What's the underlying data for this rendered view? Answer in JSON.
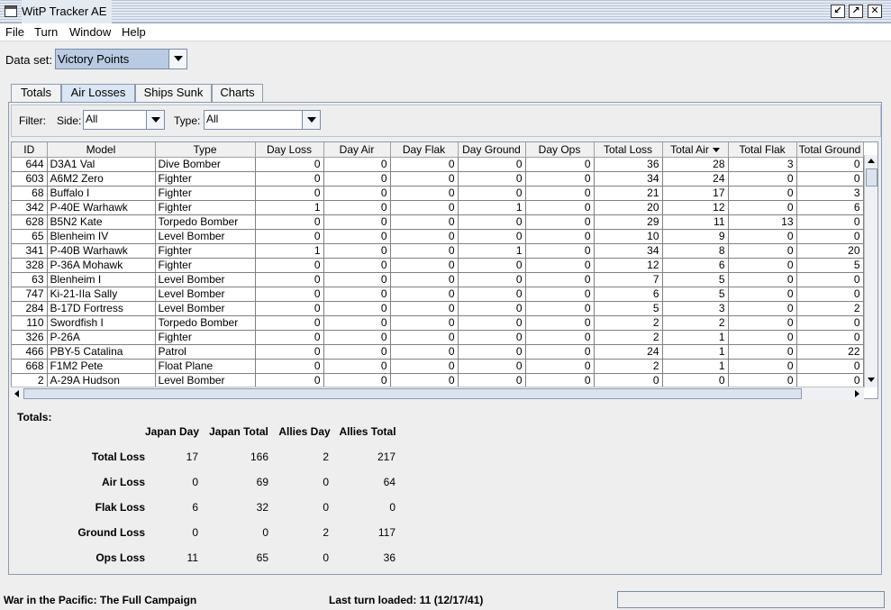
{
  "window": {
    "title": "WitP Tracker AE"
  },
  "menu": [
    "File",
    "Turn",
    "Window",
    "Help"
  ],
  "dataset": {
    "label": "Data set:",
    "value": "Victory Points"
  },
  "tabs": [
    "Totals",
    "Air Losses",
    "Ships Sunk",
    "Charts"
  ],
  "filter": {
    "label": "Filter:",
    "side_label": "Side:",
    "side_value": "All",
    "type_label": "Type:",
    "type_value": "All"
  },
  "table": {
    "columns": [
      "ID",
      "Model",
      "Type",
      "Day Loss",
      "Day Air",
      "Day Flak",
      "Day Ground",
      "Day Ops",
      "Total Loss",
      "Total Air",
      "Total Flak",
      "Total Ground"
    ],
    "rows": [
      [
        "644",
        "D3A1 Val",
        "Dive Bomber",
        "0",
        "0",
        "0",
        "0",
        "0",
        "36",
        "28",
        "3",
        "0"
      ],
      [
        "603",
        "A6M2 Zero",
        "Fighter",
        "0",
        "0",
        "0",
        "0",
        "0",
        "34",
        "24",
        "0",
        "0"
      ],
      [
        "68",
        "Buffalo I",
        "Fighter",
        "0",
        "0",
        "0",
        "0",
        "0",
        "21",
        "17",
        "0",
        "3"
      ],
      [
        "342",
        "P-40E Warhawk",
        "Fighter",
        "1",
        "0",
        "0",
        "1",
        "0",
        "20",
        "12",
        "0",
        "6"
      ],
      [
        "628",
        "B5N2 Kate",
        "Torpedo Bomber",
        "0",
        "0",
        "0",
        "0",
        "0",
        "29",
        "11",
        "13",
        "0"
      ],
      [
        "65",
        "Blenheim IV",
        "Level Bomber",
        "0",
        "0",
        "0",
        "0",
        "0",
        "10",
        "9",
        "0",
        "0"
      ],
      [
        "341",
        "P-40B Warhawk",
        "Fighter",
        "1",
        "0",
        "0",
        "1",
        "0",
        "34",
        "8",
        "0",
        "20"
      ],
      [
        "328",
        "P-36A Mohawk",
        "Fighter",
        "0",
        "0",
        "0",
        "0",
        "0",
        "12",
        "6",
        "0",
        "5"
      ],
      [
        "63",
        "Blenheim I",
        "Level Bomber",
        "0",
        "0",
        "0",
        "0",
        "0",
        "7",
        "5",
        "0",
        "0"
      ],
      [
        "747",
        "Ki-21-IIa Sally",
        "Level Bomber",
        "0",
        "0",
        "0",
        "0",
        "0",
        "6",
        "5",
        "0",
        "0"
      ],
      [
        "284",
        "B-17D Fortress",
        "Level Bomber",
        "0",
        "0",
        "0",
        "0",
        "0",
        "5",
        "3",
        "0",
        "2"
      ],
      [
        "110",
        "Swordfish I",
        "Torpedo Bomber",
        "0",
        "0",
        "0",
        "0",
        "0",
        "2",
        "2",
        "0",
        "0"
      ],
      [
        "326",
        "P-26A",
        "Fighter",
        "0",
        "0",
        "0",
        "0",
        "0",
        "2",
        "1",
        "0",
        "0"
      ],
      [
        "466",
        "PBY-5 Catalina",
        "Patrol",
        "0",
        "0",
        "0",
        "0",
        "0",
        "24",
        "1",
        "0",
        "22"
      ],
      [
        "668",
        "F1M2 Pete",
        "Float Plane",
        "0",
        "0",
        "0",
        "0",
        "0",
        "2",
        "1",
        "0",
        "0"
      ],
      [
        "2",
        "A-29A Hudson",
        "Level Bomber",
        "0",
        "0",
        "0",
        "0",
        "0",
        "0",
        "0",
        "0",
        "0"
      ]
    ]
  },
  "totals": {
    "label": "Totals:",
    "columns": [
      "Japan Day",
      "Japan Total",
      "Allies Day",
      "Allies Total"
    ],
    "rows": [
      {
        "label": "Total Loss",
        "values": [
          "17",
          "166",
          "2",
          "217"
        ]
      },
      {
        "label": "Air Loss",
        "values": [
          "0",
          "69",
          "0",
          "64"
        ]
      },
      {
        "label": "Flak Loss",
        "values": [
          "6",
          "32",
          "0",
          "0"
        ]
      },
      {
        "label": "Ground Loss",
        "values": [
          "0",
          "0",
          "2",
          "117"
        ]
      },
      {
        "label": "Ops Loss",
        "values": [
          "11",
          "65",
          "0",
          "36"
        ]
      }
    ]
  },
  "status": {
    "left": "War in the Pacific: The Full Campaign",
    "mid": "Last turn loaded: 11 (12/17/41)"
  }
}
